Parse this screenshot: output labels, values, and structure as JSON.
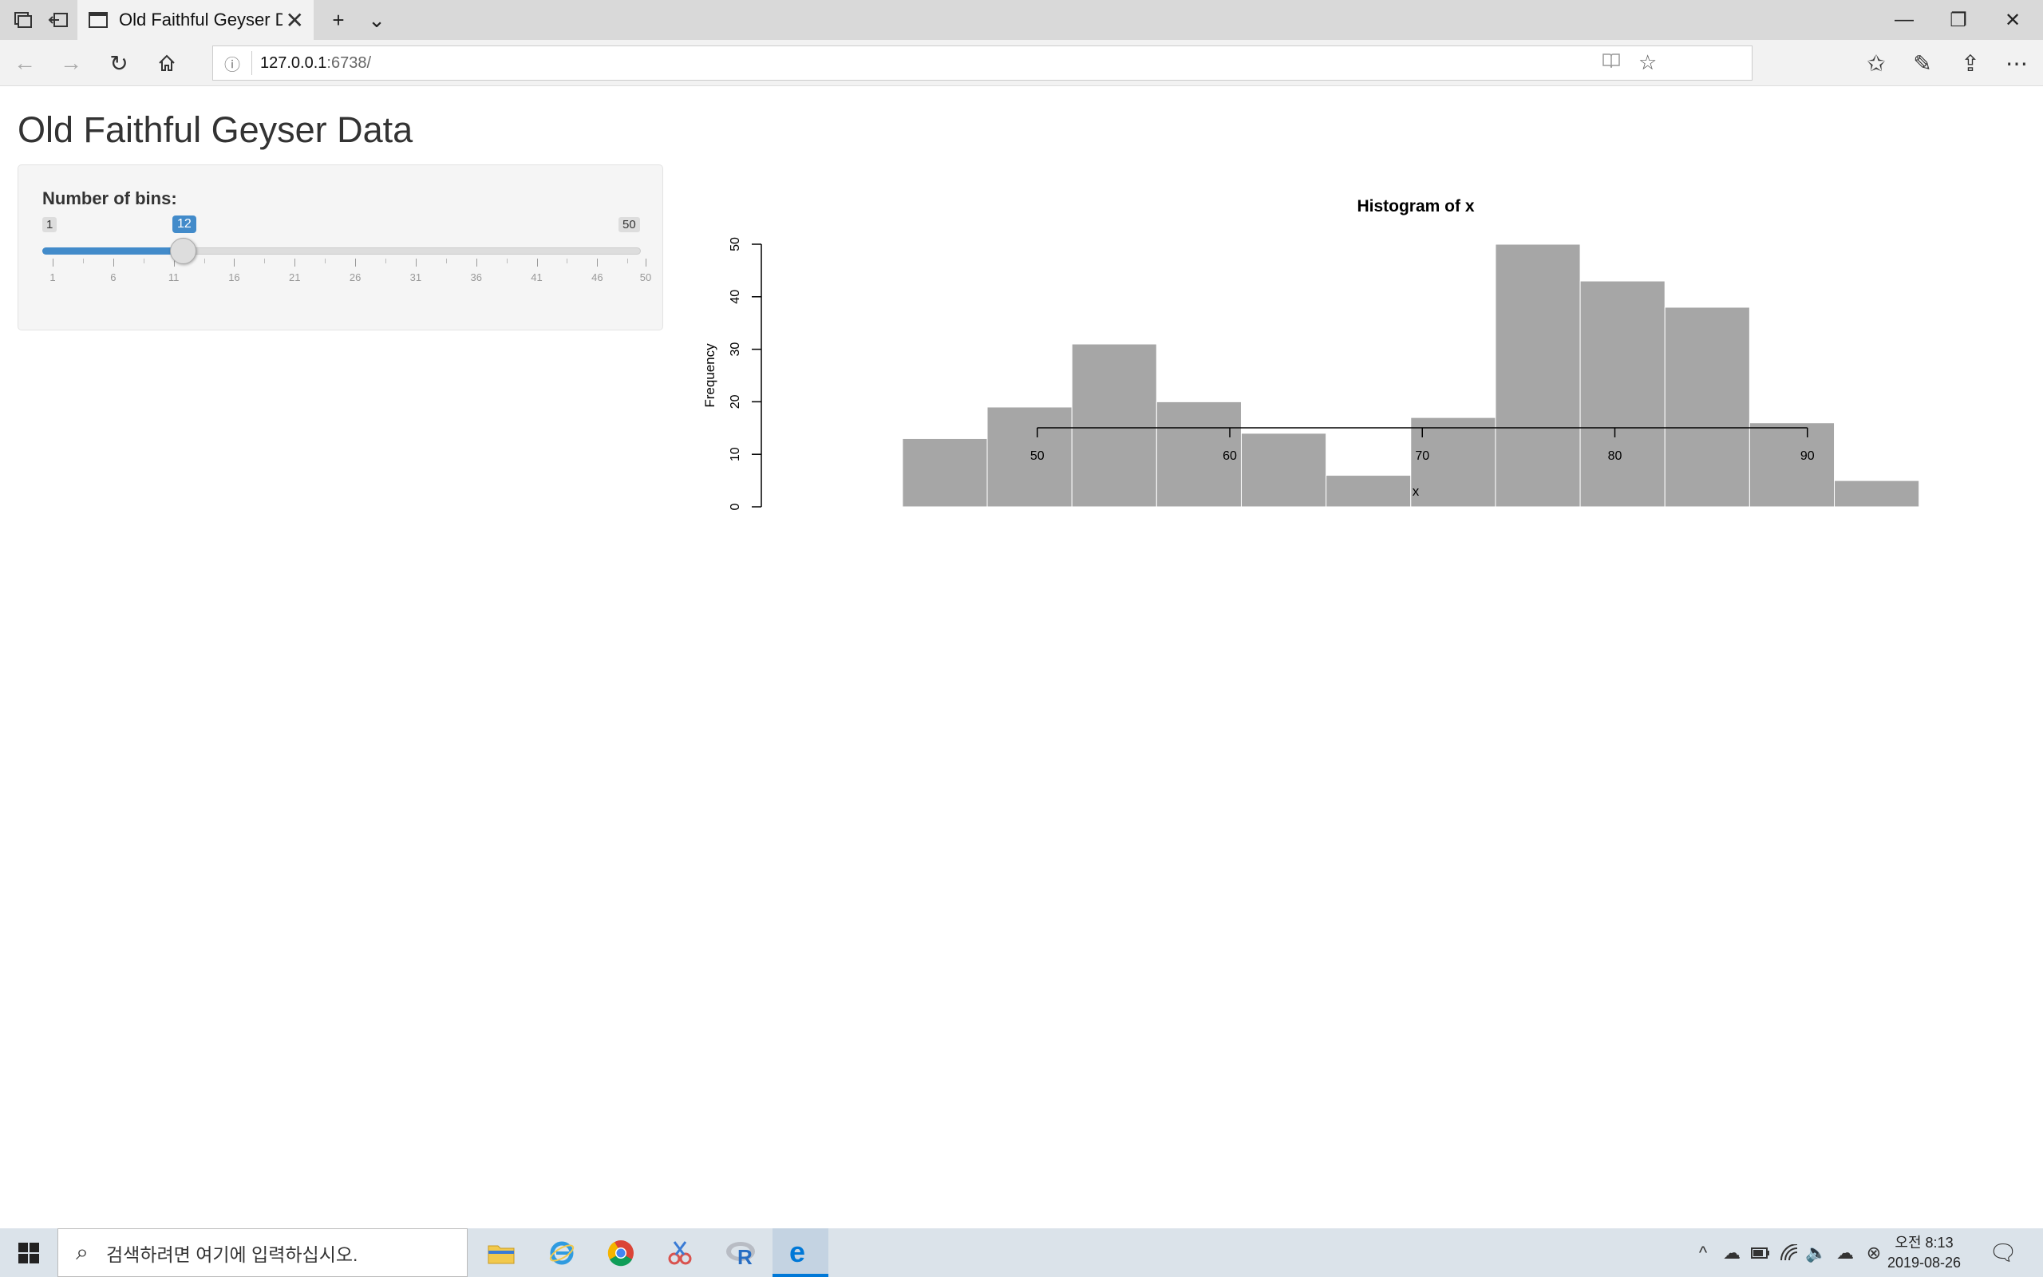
{
  "browser": {
    "tab_title": "Old Faithful Geyser Data",
    "tab_close": "✕",
    "new_tab": "+",
    "tab_dropdown": "⌄",
    "url_host": "127.0.0.1",
    "url_port": ":6738/",
    "minimize": "—",
    "restore": "❐",
    "close": "✕"
  },
  "page": {
    "title": "Old Faithful Geyser Data"
  },
  "sidebar": {
    "slider_label": "Number of bins:",
    "slider_min": "1",
    "slider_max": "50",
    "slider_value": "12",
    "slider_grid": [
      "1",
      "6",
      "11",
      "16",
      "21",
      "26",
      "31",
      "36",
      "41",
      "46",
      "50"
    ]
  },
  "chart_data": {
    "type": "bar",
    "title": "Histogram of x",
    "xlabel": "x",
    "ylabel": "Frequency",
    "bin_edges": [
      43,
      47.4,
      51.8,
      56.2,
      60.6,
      65,
      69.4,
      73.8,
      78.2,
      82.6,
      87,
      91.4,
      95.8
    ],
    "values": [
      13,
      19,
      31,
      20,
      14,
      6,
      17,
      50,
      43,
      38,
      16,
      5
    ],
    "xlim": [
      36,
      100
    ],
    "ylim": [
      0,
      50
    ],
    "x_ticks": [
      "50",
      "60",
      "70",
      "80",
      "90"
    ],
    "y_ticks": [
      "0",
      "10",
      "20",
      "30",
      "40",
      "50"
    ],
    "bar_color": "#a6a6a6",
    "grid": false
  },
  "taskbar": {
    "search_placeholder": "검색하려면 여기에 입력하십시오.",
    "time": "오전 8:13",
    "date": "2019-08-26"
  }
}
